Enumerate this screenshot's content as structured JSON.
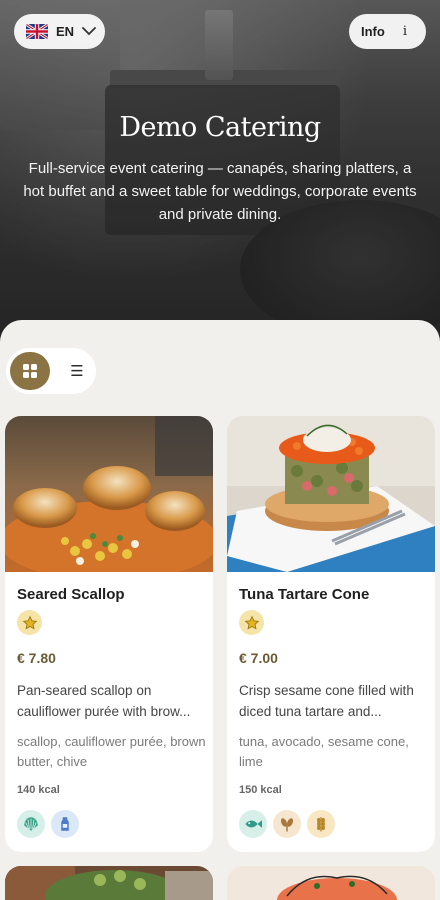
{
  "header": {
    "language_label": "EN",
    "info_label": "Info",
    "info_icon_glyph": "i"
  },
  "hero": {
    "title": "Demo Catering",
    "description": "Full-service event catering — canapés, sharing platters, a hot buffet and a sweet table for weddings, corporate events and private dining."
  },
  "view_toggle": {
    "active": "grid",
    "list_glyph": "☰"
  },
  "colors": {
    "accent": "#8c7344",
    "price": "#6b5a35",
    "background": "#f2f0ec"
  },
  "items": [
    {
      "name": "Seared Scallop",
      "price": "€ 7.80",
      "description": "Pan-seared scallop on cauliflower purée with brow...",
      "ingredients": "scallop, cauliflower purée, brown butter, chive",
      "kcal": "140 kcal",
      "allergen_icons": [
        "shellfish-icon",
        "milk-icon"
      ]
    },
    {
      "name": "Tuna Tartare Cone",
      "price": "€ 7.00",
      "description": "Crisp sesame cone filled with diced tuna tartare and...",
      "ingredients": "tuna, avocado, sesame cone, lime",
      "kcal": "150 kcal",
      "allergen_icons": [
        "fish-icon",
        "sesame-icon",
        "gluten-icon"
      ]
    }
  ]
}
